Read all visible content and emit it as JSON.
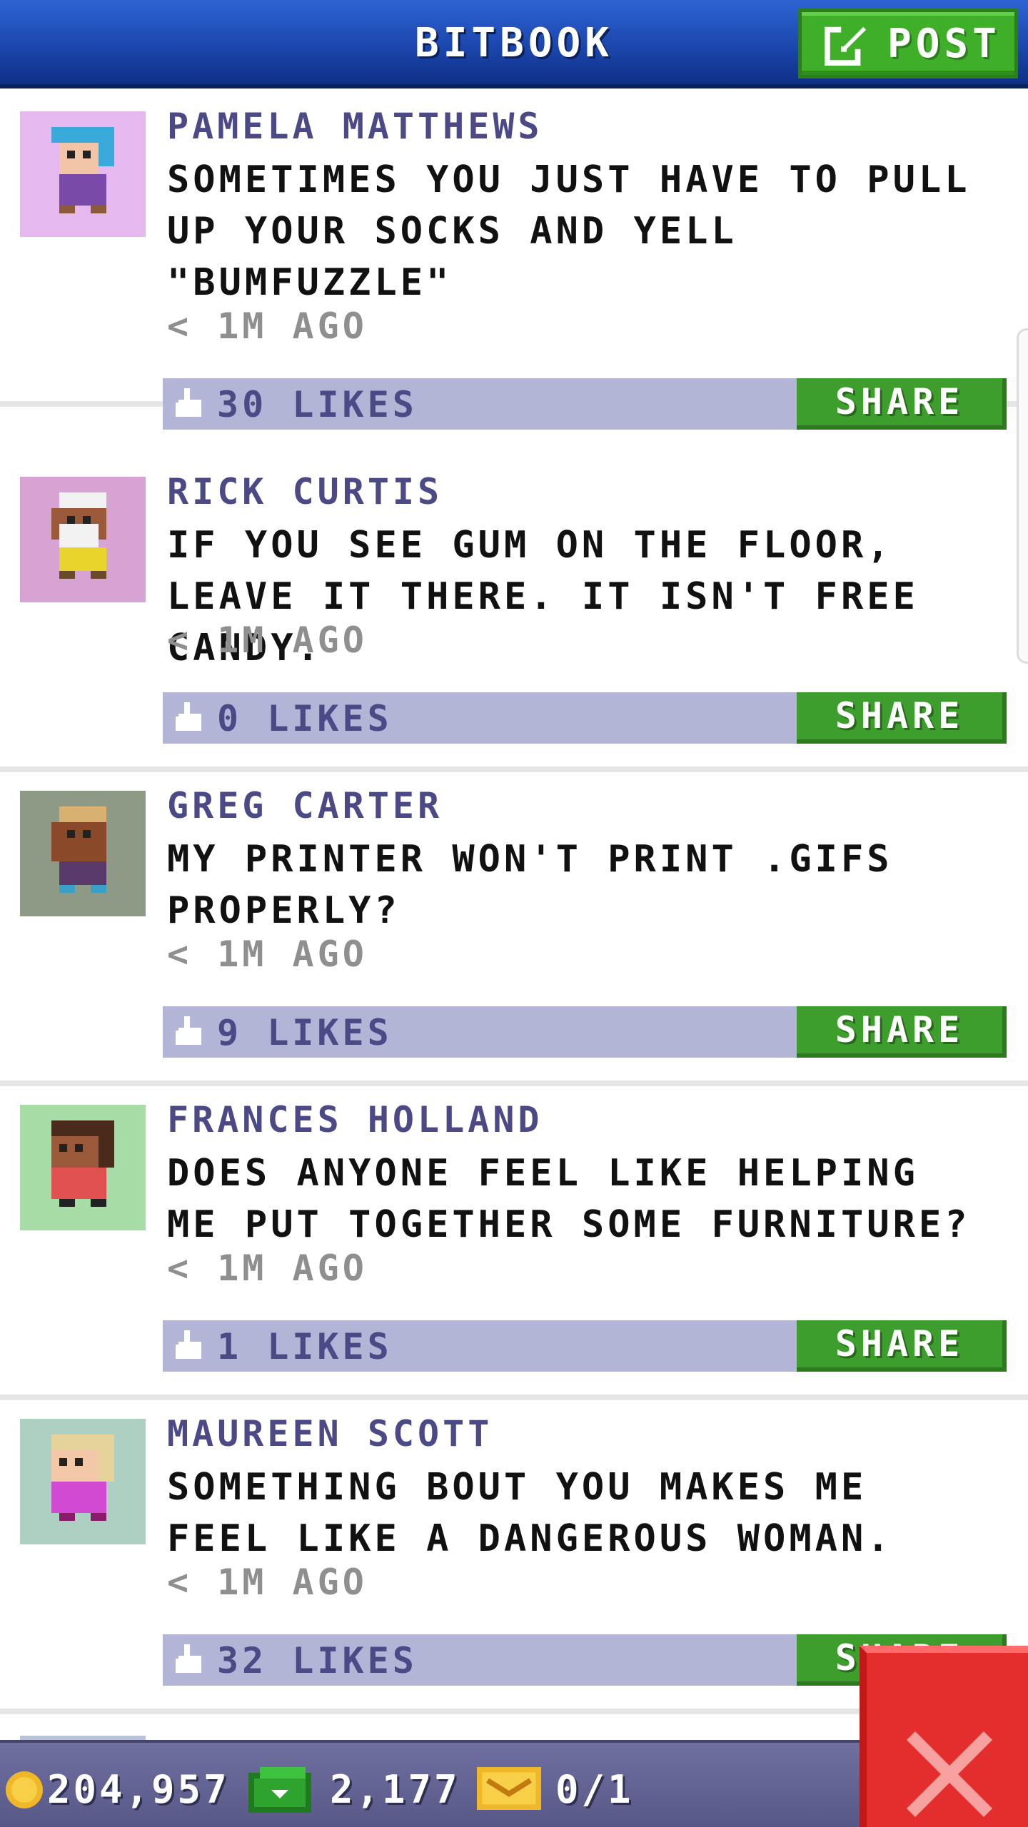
{
  "header": {
    "title": "BITBOOK",
    "post_label": "POST"
  },
  "posts": [
    {
      "author": "PAMELA MATTHEWS",
      "message": "SOMETIMES YOU JUST HAVE TO PULL UP YOUR SOCKS AND YELL \"BUMFUZZLE\"",
      "time": "< 1M AGO",
      "likes": "30 LIKES",
      "share_label": "SHARE"
    },
    {
      "author": "RICK CURTIS",
      "message": "IF YOU SEE GUM ON THE FLOOR, LEAVE IT THERE. IT ISN'T FREE CANDY.",
      "time": "< 1M AGO",
      "likes": "0 LIKES",
      "share_label": "SHARE"
    },
    {
      "author": "GREG CARTER",
      "message": "MY PRINTER WON'T PRINT .GIFS PROPERLY?",
      "time": "< 1M AGO",
      "likes": "9 LIKES",
      "share_label": "SHARE"
    },
    {
      "author": "FRANCES HOLLAND",
      "message": "DOES ANYONE FEEL LIKE HELPING ME PUT TOGETHER SOME FURNITURE?",
      "time": "< 1M AGO",
      "likes": "1 LIKES",
      "share_label": "SHARE"
    },
    {
      "author": "MAUREEN SCOTT",
      "message": "SOMETHING BOUT YOU MAKES ME FEEL LIKE A DANGEROUS WOMAN.",
      "time": "< 1M AGO",
      "likes": "32 LIKES",
      "share_label": "SHARE"
    }
  ],
  "avatar_colors": [
    "#e6b8f0",
    "#d7a3d3",
    "#8e9a86",
    "#a6dca6",
    "#aed0c2"
  ],
  "status": {
    "coins": "204,957",
    "cash": "2,177",
    "tickets": "0/1"
  },
  "colors": {
    "header_blue": "#1b47ad",
    "post_green": "#3fae29",
    "like_bar": "#b2b5d6",
    "name_purple": "#4c4a86",
    "close_red": "#e42d2d"
  },
  "icons": {
    "post": "edit-icon",
    "like": "thumbs-up-icon",
    "coin": "coin-icon",
    "cash": "cash-icon",
    "ticket": "ticket-icon",
    "close": "close-icon"
  }
}
